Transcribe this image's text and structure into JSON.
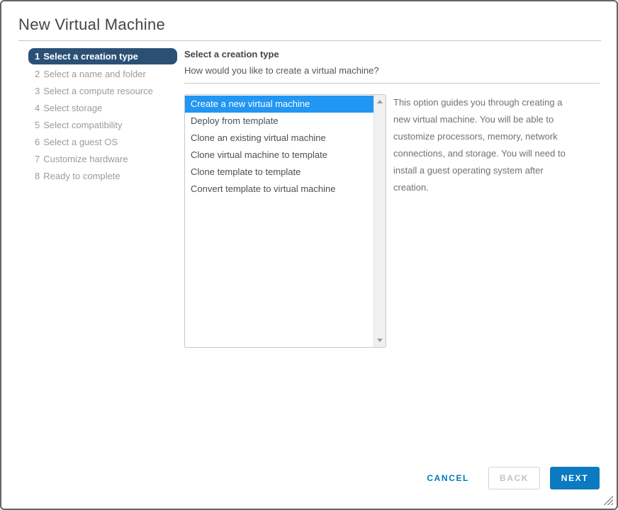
{
  "dialog": {
    "title": "New Virtual Machine"
  },
  "steps": [
    {
      "number": "1",
      "label": "Select a creation type",
      "state": "active"
    },
    {
      "number": "2",
      "label": "Select a name and folder",
      "state": "upcoming"
    },
    {
      "number": "3",
      "label": "Select a compute resource",
      "state": "upcoming"
    },
    {
      "number": "4",
      "label": "Select storage",
      "state": "upcoming"
    },
    {
      "number": "5",
      "label": "Select compatibility",
      "state": "upcoming"
    },
    {
      "number": "6",
      "label": "Select a guest OS",
      "state": "upcoming"
    },
    {
      "number": "7",
      "label": "Customize hardware",
      "state": "upcoming"
    },
    {
      "number": "8",
      "label": "Ready to complete",
      "state": "upcoming"
    }
  ],
  "content": {
    "heading": "Select a creation type",
    "question": "How would you like to create a virtual machine?",
    "options": [
      "Create a new virtual machine",
      "Deploy from template",
      "Clone an existing virtual machine",
      "Clone virtual machine to template",
      "Clone template to template",
      "Convert template to virtual machine"
    ],
    "selected_option": "Create a new virtual machine",
    "description_lines": [
      "This option guides you through creating a",
      "new virtual machine. You will be able to",
      "customize processors, memory, network",
      "connections, and storage. You will need to",
      "install a guest operating system after",
      "creation."
    ]
  },
  "footer": {
    "cancel_label": "CANCEL",
    "back_label": "BACK",
    "next_label": "NEXT"
  },
  "colors": {
    "active_step_bg": "#2b5075",
    "selected_option_bg": "#2196f3",
    "primary_button_bg": "#0b7ac1",
    "link_blue": "#0079b8"
  }
}
